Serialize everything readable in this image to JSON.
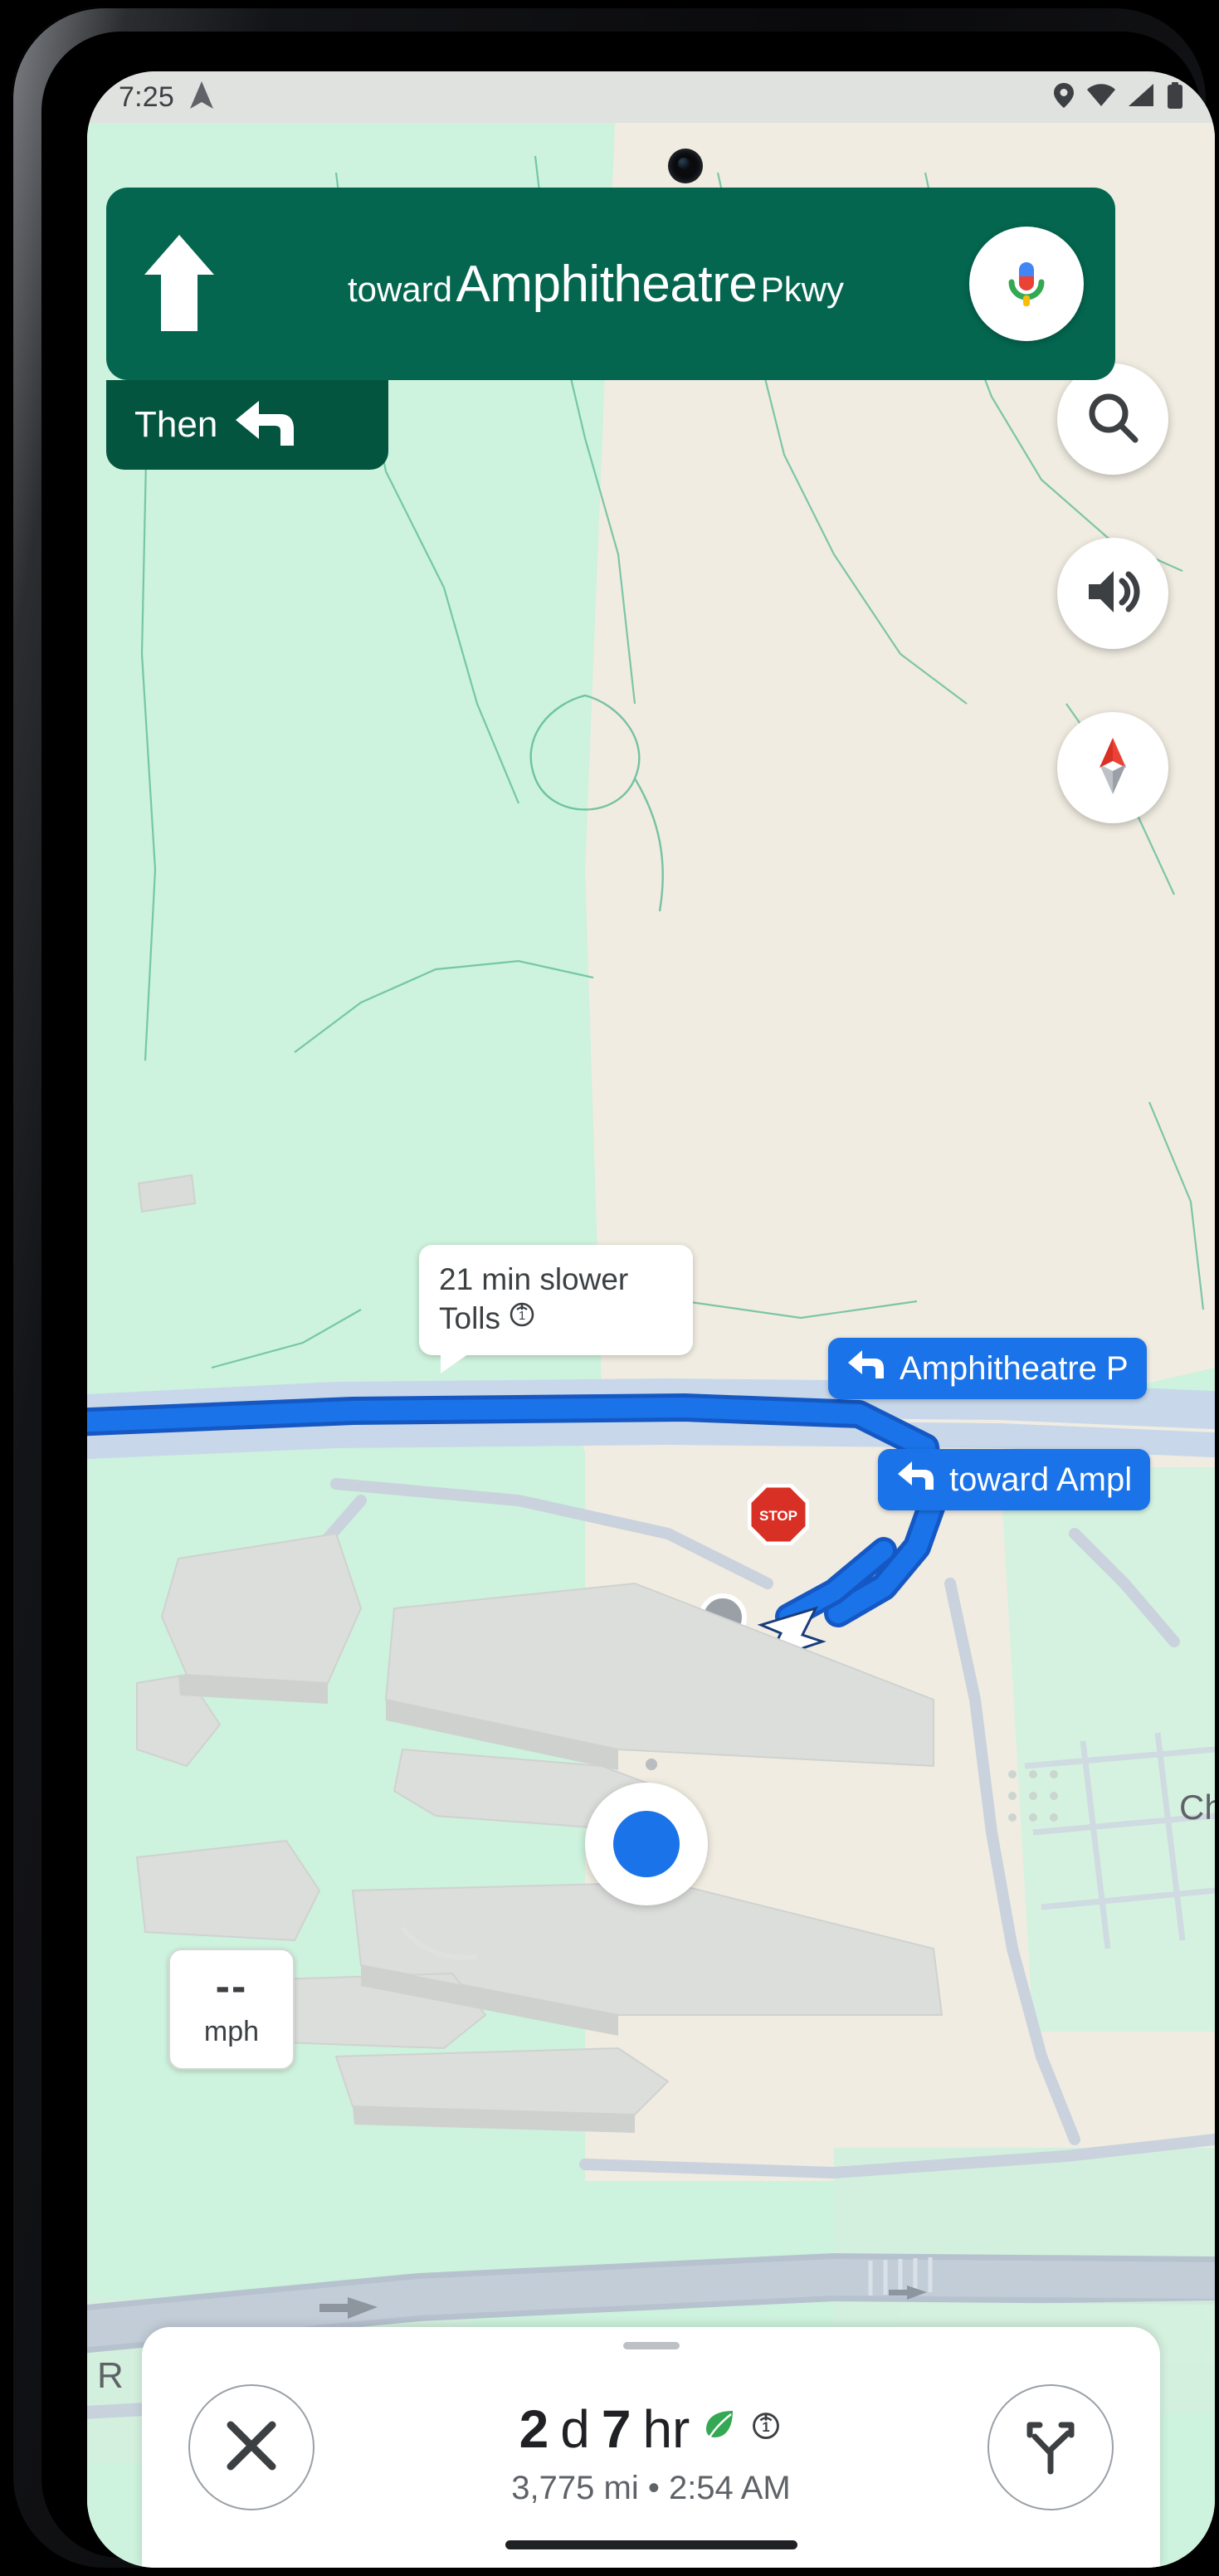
{
  "device": {
    "status_bar": {
      "time": "7:25",
      "nav_arrow_icon": "navigation-arrow-icon",
      "icons": [
        "location-pin-icon",
        "wifi-icon",
        "cellular-signal-icon",
        "battery-icon"
      ]
    },
    "gesture_bar": "home-gesture-bar"
  },
  "navigation": {
    "maneuver": {
      "icon": "straight-arrow-up-icon",
      "prefix": "toward",
      "primary": "Amphitheatre",
      "suffix": "Pkwy",
      "banner_color": "#04664f"
    },
    "then": {
      "label": "Then",
      "icon": "turn-left-arrow-icon",
      "chip_color": "#04553f"
    },
    "mic_button": {
      "icon": "google-assistant-mic-icon",
      "label": "Voice search"
    }
  },
  "map_controls": [
    {
      "name": "search-fab",
      "icon": "search-icon"
    },
    {
      "name": "sound-fab",
      "icon": "speaker-volume-icon"
    },
    {
      "name": "compass-fab",
      "icon": "compass-needle-icon"
    }
  ],
  "map_overlays": {
    "tolls_tooltip": {
      "line1": "21 min slower",
      "line2": "Tolls",
      "toll_icon": "toll-coin-icon"
    },
    "route_chips": [
      {
        "icon": "turn-left-arrow-icon",
        "label": "Amphitheatre P"
      },
      {
        "icon": "turn-left-arrow-icon",
        "label": "toward Ampl"
      }
    ],
    "stop_sign": {
      "label": "STOP",
      "color": "#d93025"
    },
    "street_label": "E Charleston Rd",
    "partial_label_right": "Ch",
    "partial_label_left": "R",
    "user_location_icon": "blue-dot-location-icon",
    "route_color": "#1a73e8"
  },
  "speed": {
    "value": "--",
    "unit": "mph"
  },
  "bottom_sheet": {
    "close_button": {
      "icon": "close-x-icon",
      "label": "Exit navigation"
    },
    "routes_button": {
      "icon": "route-alternatives-icon",
      "label": "Route options"
    },
    "eta": {
      "days_value": "2",
      "days_unit": "d",
      "hours_value": "7",
      "hours_unit": "hr",
      "eco_icon": "eco-leaf-icon",
      "toll_icon": "toll-coin-icon"
    },
    "details": "3,775 mi  •  2:54 AM",
    "distance": "3,775 mi",
    "separator": "•",
    "arrival_time": "2:54 AM"
  },
  "colors": {
    "brand_green": "#04664f",
    "route_blue": "#1a73e8",
    "map_green": "#cdf2dd",
    "map_beige": "#f0ece1",
    "status_bg": "#e0e2e0"
  }
}
